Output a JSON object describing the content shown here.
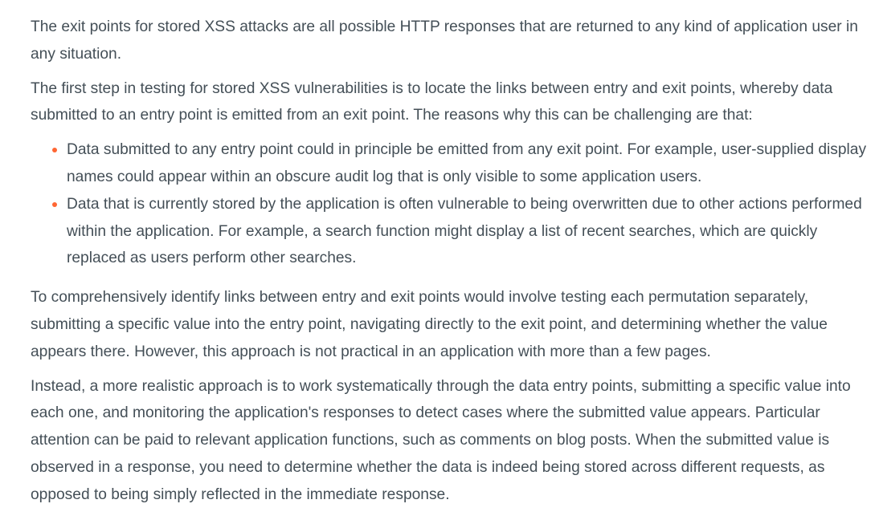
{
  "article": {
    "p1": "The exit points for stored XSS attacks are all possible HTTP responses that are returned to any kind of application user in any situation.",
    "p2": "The first step in testing for stored XSS vulnerabilities is to locate the links between entry and exit points, whereby data submitted to an entry point is emitted from an exit point. The reasons why this can be challenging are that:",
    "bullets": [
      "Data submitted to any entry point could in principle be emitted from any exit point. For example, user-supplied display names could appear within an obscure audit log that is only visible to some application users.",
      "Data that is currently stored by the application is often vulnerable to being overwritten due to other actions performed within the application. For example, a search function might display a list of recent searches, which are quickly replaced as users perform other searches."
    ],
    "p3": "To comprehensively identify links between entry and exit points would involve testing each permutation separately, submitting a specific value into the entry point, navigating directly to the exit point, and determining whether the value appears there. However, this approach is not practical in an application with more than a few pages.",
    "p4": "Instead, a more realistic approach is to work systematically through the data entry points, submitting a specific value into each one, and monitoring the application's responses to detect cases where the submitted value appears. Particular attention can be paid to relevant application functions, such as comments on blog posts. When the submitted value is observed in a response, you need to determine whether the data is indeed being stored across different requests, as opposed to being simply reflected in the immediate response."
  },
  "colors": {
    "text": "#444f57",
    "bullet": "#ff6633",
    "background": "#ffffff"
  }
}
